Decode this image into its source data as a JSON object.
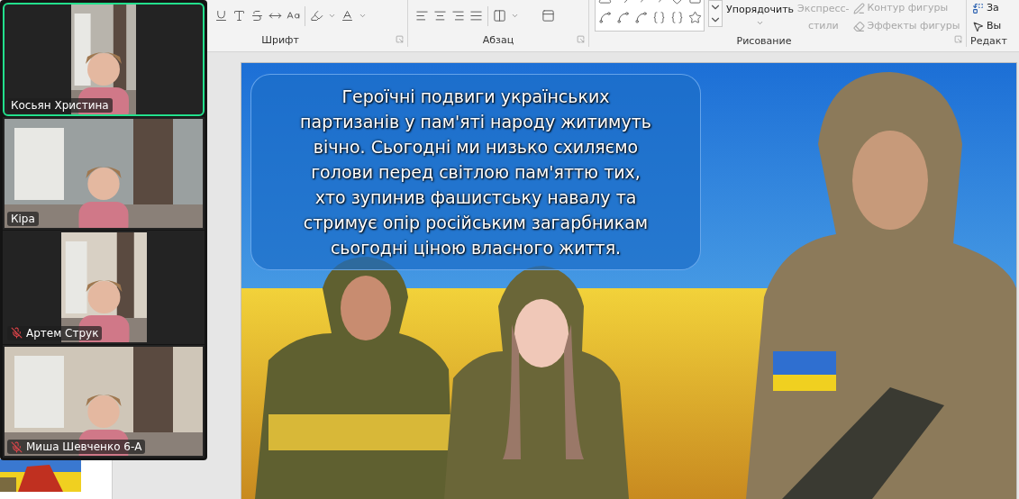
{
  "ribbon": {
    "font": {
      "label": "Шрифт"
    },
    "paragraph": {
      "label": "Абзац"
    },
    "drawing": {
      "label": "Рисование",
      "arrange": "Упорядочить",
      "quick_styles": {
        "lines": [
          "Экспресс-",
          "стили"
        ],
        "disabled": true
      },
      "outline": {
        "label": "Контур фигуры",
        "disabled": true
      },
      "effects": {
        "label": "Эффекты фигуры",
        "disabled": true
      }
    },
    "editing": {
      "label": "Редакт",
      "replace": "За",
      "select": "Вы"
    }
  },
  "slide": {
    "text_lines": [
      "Героїчні подвиги українських",
      "партизанів у пам'яті народу житимуть",
      "вічно. Сьогодні ми низько схиляємо",
      "голови перед світлою пам'яттю тих,",
      "хто зупинив фашистську навалу та",
      "стримує опір російським загарбникам",
      "сьогодні ціною власного життя."
    ]
  },
  "participants": [
    {
      "name": "Косьян Христина",
      "active": true,
      "muted": false,
      "kind": "portrait"
    },
    {
      "name": "Кіра",
      "active": false,
      "muted": false,
      "kind": "landscape"
    },
    {
      "name": "Артем Струк",
      "active": false,
      "muted": true,
      "kind": "portrait"
    },
    {
      "name": "Миша Шевченко 6-А",
      "active": false,
      "muted": true,
      "kind": "landscape"
    }
  ]
}
